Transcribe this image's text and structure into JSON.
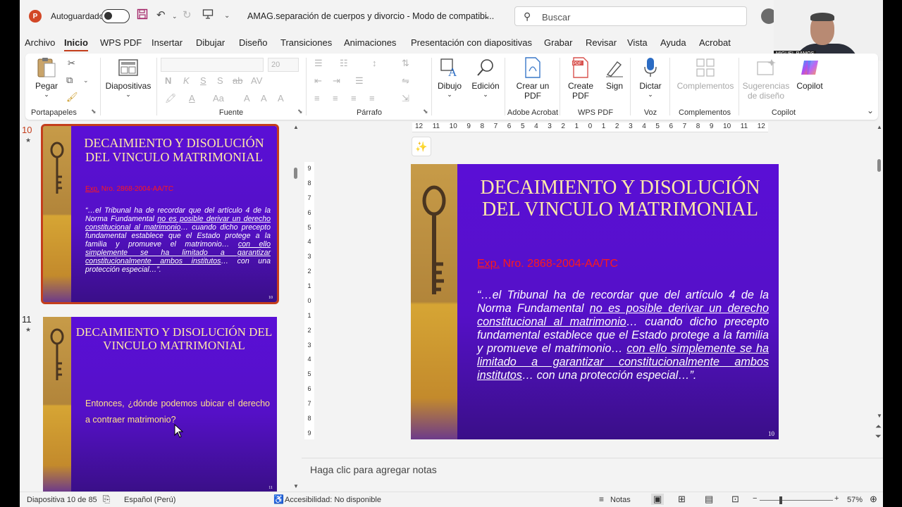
{
  "app": {
    "autosave_label": "Autoguardado",
    "doc_title": "AMAG.separación de cuerpos y divorcio  -  Modo de compatibi...",
    "search_placeholder": "Buscar",
    "video_name": "MIGUEL RAMOS"
  },
  "tabs": [
    "Archivo",
    "Inicio",
    "WPS PDF",
    "Insertar",
    "Dibujar",
    "Diseño",
    "Transiciones",
    "Animaciones",
    "Presentación con diapositivas",
    "Grabar",
    "Revisar",
    "Vista",
    "Ayuda",
    "Acrobat"
  ],
  "ribbon": {
    "pegar": "Pegar",
    "portapapeles": "Portapapeles",
    "diapositivas": "Diapositivas",
    "fuente": "Fuente",
    "font_size": "20",
    "parrafo": "Párrafo",
    "dibujo": "Dibujo",
    "edicion": "Edición",
    "crear_pdf": "Crear un PDF",
    "adobe_acrobat": "Adobe Acrobat",
    "create_pdf": "Create PDF",
    "sign": "Sign",
    "wps_pdf": "WPS PDF",
    "dictar": "Dictar",
    "voz": "Voz",
    "complementos_btn": "Complementos",
    "complementos": "Complementos",
    "sugerencias": "Sugerencias de diseño",
    "copilot_btn": "Copilot",
    "copilot": "Copilot"
  },
  "thumbs": {
    "slide10_num": "10",
    "slide11_num": "11",
    "slide11_title": "DECAIMIENTO Y DISOLUCIÓN DEL VINCULO MATRIMONIAL",
    "slide11_body": "Entonces, ¿dónde podemos ubicar el derecho a contraer matrimonio?",
    "slide11_page": "11"
  },
  "slide": {
    "title": "DECAIMIENTO Y DISOLUCIÓN DEL VINCULO MATRIMONIAL",
    "exp_prefix": "Exp.",
    "exp_rest": " Nro. 2868-2004-AA/TC",
    "q1": "“…el Tribunal ha de recordar que del artículo 4 de la Norma Fundamental ",
    "q2": "no es posible derivar un derecho constitucional al matrimonio",
    "q3": "… cuando dicho precepto fundamental establece que el Estado protege a la familia y promueve el matrimonio… ",
    "q4": "con ello simplemente se ha limitado a garantizar constitucionalmente ambos institutos",
    "q5": "… con una protección especial…”.",
    "page": "10"
  },
  "ruler_h": [
    "12",
    "11",
    "10",
    "9",
    "8",
    "7",
    "6",
    "5",
    "4",
    "3",
    "2",
    "1",
    "0",
    "1",
    "2",
    "3",
    "4",
    "5",
    "6",
    "7",
    "8",
    "9",
    "10",
    "11",
    "12"
  ],
  "ruler_v": [
    "9",
    "8",
    "7",
    "6",
    "5",
    "4",
    "3",
    "2",
    "1",
    "0",
    "1",
    "2",
    "3",
    "4",
    "5",
    "6",
    "7",
    "8",
    "9"
  ],
  "notes_placeholder": "Haga clic para agregar notas",
  "status": {
    "slide_count": "Diapositiva 10 de 85",
    "language": "Español (Perú)",
    "accessibility": "Accesibilidad: No disponible",
    "notes": "Notas",
    "zoom": "57%"
  }
}
